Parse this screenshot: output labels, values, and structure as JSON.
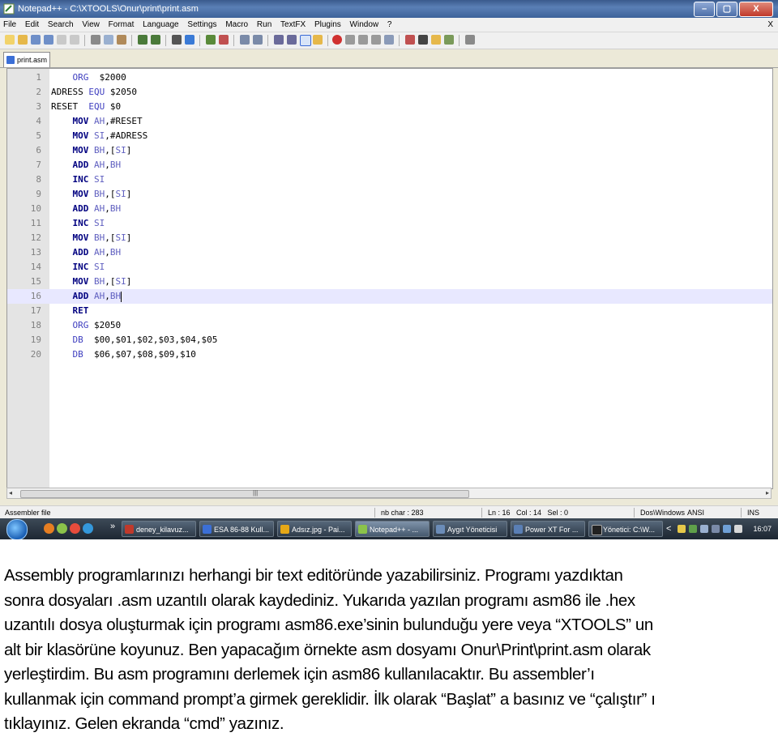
{
  "window": {
    "title": "Notepad++ - C:\\XTOOLS\\Onur\\print\\print.asm",
    "minimize": "–",
    "maximize": "▢",
    "close": "X"
  },
  "menu": {
    "items": [
      "File",
      "Edit",
      "Search",
      "View",
      "Format",
      "Language",
      "Settings",
      "Macro",
      "Run",
      "TextFX",
      "Plugins",
      "Window",
      "?"
    ],
    "close_doc": "X"
  },
  "tab": {
    "label": "print.asm"
  },
  "editor": {
    "current_line": 16,
    "lines": [
      {
        "n": "1",
        "tokens": [
          {
            "t": "    ",
            "c": ""
          },
          {
            "t": "ORG",
            "c": "dir"
          },
          {
            "t": "  $2000",
            "c": ""
          }
        ]
      },
      {
        "n": "2",
        "tokens": [
          {
            "t": "ADRESS ",
            "c": ""
          },
          {
            "t": "EQU",
            "c": "dir"
          },
          {
            "t": " $2050",
            "c": ""
          }
        ]
      },
      {
        "n": "3",
        "tokens": [
          {
            "t": "RESET  ",
            "c": ""
          },
          {
            "t": "EQU",
            "c": "dir"
          },
          {
            "t": " $0",
            "c": ""
          }
        ]
      },
      {
        "n": "4",
        "tokens": [
          {
            "t": "    ",
            "c": ""
          },
          {
            "t": "MOV",
            "c": "kw"
          },
          {
            "t": " ",
            "c": ""
          },
          {
            "t": "AH",
            "c": "reg"
          },
          {
            "t": ",#RESET",
            "c": ""
          }
        ]
      },
      {
        "n": "5",
        "tokens": [
          {
            "t": "    ",
            "c": ""
          },
          {
            "t": "MOV",
            "c": "kw"
          },
          {
            "t": " ",
            "c": ""
          },
          {
            "t": "SI",
            "c": "reg"
          },
          {
            "t": ",#ADRESS",
            "c": ""
          }
        ]
      },
      {
        "n": "6",
        "tokens": [
          {
            "t": "    ",
            "c": ""
          },
          {
            "t": "MOV",
            "c": "kw"
          },
          {
            "t": " ",
            "c": ""
          },
          {
            "t": "BH",
            "c": "reg"
          },
          {
            "t": ",[",
            "c": ""
          },
          {
            "t": "SI",
            "c": "reg"
          },
          {
            "t": "]",
            "c": ""
          }
        ]
      },
      {
        "n": "7",
        "tokens": [
          {
            "t": "    ",
            "c": ""
          },
          {
            "t": "ADD",
            "c": "kw"
          },
          {
            "t": " ",
            "c": ""
          },
          {
            "t": "AH",
            "c": "reg"
          },
          {
            "t": ",",
            "c": ""
          },
          {
            "t": "BH",
            "c": "reg"
          }
        ]
      },
      {
        "n": "8",
        "tokens": [
          {
            "t": "    ",
            "c": ""
          },
          {
            "t": "INC",
            "c": "kw"
          },
          {
            "t": " ",
            "c": ""
          },
          {
            "t": "SI",
            "c": "reg"
          }
        ]
      },
      {
        "n": "9",
        "tokens": [
          {
            "t": "    ",
            "c": ""
          },
          {
            "t": "MOV",
            "c": "kw"
          },
          {
            "t": " ",
            "c": ""
          },
          {
            "t": "BH",
            "c": "reg"
          },
          {
            "t": ",[",
            "c": ""
          },
          {
            "t": "SI",
            "c": "reg"
          },
          {
            "t": "]",
            "c": ""
          }
        ]
      },
      {
        "n": "10",
        "tokens": [
          {
            "t": "    ",
            "c": ""
          },
          {
            "t": "ADD",
            "c": "kw"
          },
          {
            "t": " ",
            "c": ""
          },
          {
            "t": "AH",
            "c": "reg"
          },
          {
            "t": ",",
            "c": ""
          },
          {
            "t": "BH",
            "c": "reg"
          }
        ]
      },
      {
        "n": "11",
        "tokens": [
          {
            "t": "    ",
            "c": ""
          },
          {
            "t": "INC",
            "c": "kw"
          },
          {
            "t": " ",
            "c": ""
          },
          {
            "t": "SI",
            "c": "reg"
          }
        ]
      },
      {
        "n": "12",
        "tokens": [
          {
            "t": "    ",
            "c": ""
          },
          {
            "t": "MOV",
            "c": "kw"
          },
          {
            "t": " ",
            "c": ""
          },
          {
            "t": "BH",
            "c": "reg"
          },
          {
            "t": ",[",
            "c": ""
          },
          {
            "t": "SI",
            "c": "reg"
          },
          {
            "t": "]",
            "c": ""
          }
        ]
      },
      {
        "n": "13",
        "tokens": [
          {
            "t": "    ",
            "c": ""
          },
          {
            "t": "ADD",
            "c": "kw"
          },
          {
            "t": " ",
            "c": ""
          },
          {
            "t": "AH",
            "c": "reg"
          },
          {
            "t": ",",
            "c": ""
          },
          {
            "t": "BH",
            "c": "reg"
          }
        ]
      },
      {
        "n": "14",
        "tokens": [
          {
            "t": "    ",
            "c": ""
          },
          {
            "t": "INC",
            "c": "kw"
          },
          {
            "t": " ",
            "c": ""
          },
          {
            "t": "SI",
            "c": "reg"
          }
        ]
      },
      {
        "n": "15",
        "tokens": [
          {
            "t": "    ",
            "c": ""
          },
          {
            "t": "MOV",
            "c": "kw"
          },
          {
            "t": " ",
            "c": ""
          },
          {
            "t": "BH",
            "c": "reg"
          },
          {
            "t": ",[",
            "c": ""
          },
          {
            "t": "SI",
            "c": "reg"
          },
          {
            "t": "]",
            "c": ""
          }
        ]
      },
      {
        "n": "16",
        "tokens": [
          {
            "t": "    ",
            "c": ""
          },
          {
            "t": "ADD",
            "c": "kw"
          },
          {
            "t": " ",
            "c": ""
          },
          {
            "t": "AH",
            "c": "reg"
          },
          {
            "t": ",",
            "c": ""
          },
          {
            "t": "BH",
            "c": "reg"
          }
        ]
      },
      {
        "n": "17",
        "tokens": [
          {
            "t": "    ",
            "c": ""
          },
          {
            "t": "RET",
            "c": "kw"
          }
        ]
      },
      {
        "n": "18",
        "tokens": [
          {
            "t": "    ",
            "c": ""
          },
          {
            "t": "ORG",
            "c": "dir"
          },
          {
            "t": " $2050",
            "c": ""
          }
        ]
      },
      {
        "n": "19",
        "tokens": [
          {
            "t": "    ",
            "c": ""
          },
          {
            "t": "DB",
            "c": "dir"
          },
          {
            "t": "  $00,$01,$02,$03,$04,$05",
            "c": ""
          }
        ]
      },
      {
        "n": "20",
        "tokens": [
          {
            "t": "    ",
            "c": ""
          },
          {
            "t": "DB",
            "c": "dir"
          },
          {
            "t": "  $06,$07,$08,$09,$10",
            "c": ""
          }
        ]
      }
    ]
  },
  "scrollbar": {
    "left_arrow": "◂",
    "right_arrow": "▸",
    "grip": "|||"
  },
  "status": {
    "lang": "Assembler file",
    "nbchar": "nb char : 283",
    "pos": "Ln : 16   Col : 14   Sel : 0",
    "eol": "Dos\\Windows",
    "enc": "ANSI",
    "mode": "INS"
  },
  "taskbar": {
    "buttons": [
      {
        "label": "deney_kilavuz...",
        "color": "#c0392b",
        "active": false
      },
      {
        "label": "ESA 86-88 Kull...",
        "color": "#3b6fd6",
        "active": false
      },
      {
        "label": "Adsız.jpg - Pai...",
        "color": "#e6a817",
        "active": false
      },
      {
        "label": "Notepad++ - ...",
        "color": "#8bc34a",
        "active": true
      },
      {
        "label": "Aygıt Yöneticisi",
        "color": "#6b8cb8",
        "active": false
      },
      {
        "label": "Power XT For ...",
        "color": "#5a7fb5",
        "active": false
      },
      {
        "label": "Yönetici: C:\\W...",
        "color": "#222222",
        "active": false
      }
    ],
    "more": "»",
    "chevron": "<",
    "clock": "16:07"
  },
  "paragraph": [
    "Assembly programlarınızı herhangi bir text editöründe yazabilirsiniz. Programı yazdıktan",
    "sonra dosyaları .asm uzantılı olarak kaydediniz. Yukarıda yazılan programı asm86 ile .hex",
    "uzantılı dosya oluşturmak için programı asm86.exe’sinin bulunduğu yere veya “XTOOLS” un",
    "alt bir klasörüne koyunuz. Ben yapacağım örnekte asm dosyamı Onur\\Print\\print.asm olarak",
    "yerleştirdim. Bu asm programını derlemek için asm86 kullanılacaktır. Bu assembler’ı",
    "kullanmak için command prompt’a girmek gereklidir. İlk olarak “Başlat” a basınız ve “çalıştır” ı",
    "tıklayınız. Gelen ekranda “cmd” yazınız."
  ]
}
